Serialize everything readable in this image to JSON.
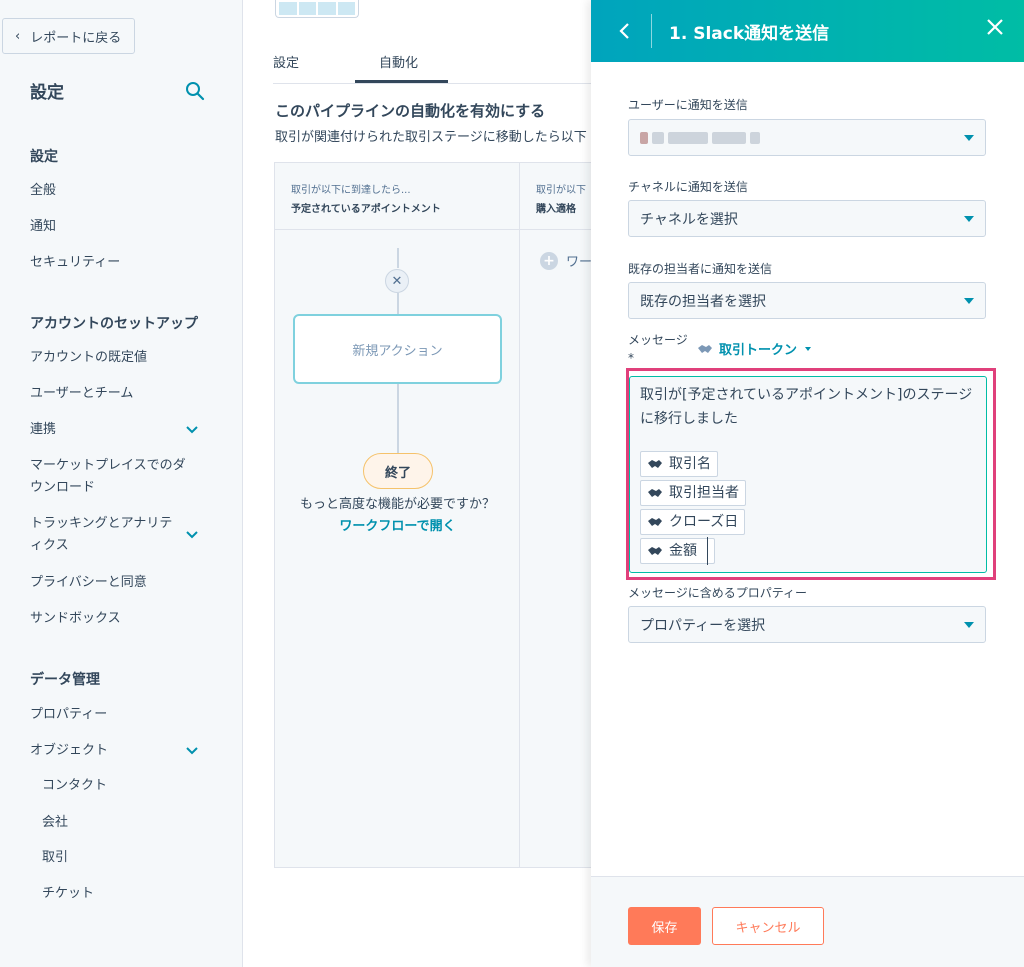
{
  "sidebar": {
    "back_label": "レポートに戻る",
    "title": "設定",
    "sections": {
      "settings": "設定",
      "account_setup": "アカウントのセットアップ",
      "data_mgmt": "データ管理"
    },
    "items": {
      "general": "全般",
      "notifications": "通知",
      "security": "セキュリティー",
      "account_defaults": "アカウントの既定値",
      "users_teams": "ユーザーとチーム",
      "integrations": "連携",
      "marketplace": "マーケットプレイスでのダウンロード",
      "tracking": "トラッキングとアナリティクス",
      "privacy": "プライバシーと同意",
      "sandbox": "サンドボックス",
      "properties": "プロパティー",
      "objects": "オブジェクト",
      "contacts": "コンタクト",
      "companies": "会社",
      "deals": "取引",
      "tickets": "チケット"
    }
  },
  "main": {
    "tabs": [
      "設定",
      "自動化"
    ],
    "heading": "このパイプラインの自動化を有効にする",
    "subtext": "取引が関連付けられた取引ステージに移動したら以下",
    "col1": {
      "trigger": "取引が以下に到達したら...",
      "stage": "予定されているアポイントメント"
    },
    "col2": {
      "trigger": "取引が以下",
      "stage": "購入適格"
    },
    "new_action": "新規アクション",
    "end": "終了",
    "advanced": "もっと高度な機能が必要ですか？",
    "workflow_link": "ワークフローで開く",
    "col2_add": "ワー"
  },
  "panel": {
    "title": "1. Slack通知を送信",
    "user_label": "ユーザーに通知を送信",
    "channel_label": "チャネルに通知を送信",
    "channel_value": "チャネルを選択",
    "owner_label": "既存の担当者に通知を送信",
    "owner_value": "既存の担当者を選択",
    "message_label": "メッセージ *",
    "token_link": "取引トークン",
    "message_text": "取引が[予定されているアポイントメント]のステージに移行しました",
    "tokens": [
      "取引名",
      "取引担当者",
      "クローズ日",
      "金額"
    ],
    "props_label": "メッセージに含めるプロパティー",
    "props_value": "プロパティーを選択",
    "save": "保存",
    "cancel": "キャンセル"
  },
  "colors": {
    "header_start": "#00a4bd",
    "header_end": "#00bda5",
    "primary_button": "#ff7a59",
    "highlight": "#e0407b",
    "link": "#0091ae"
  }
}
